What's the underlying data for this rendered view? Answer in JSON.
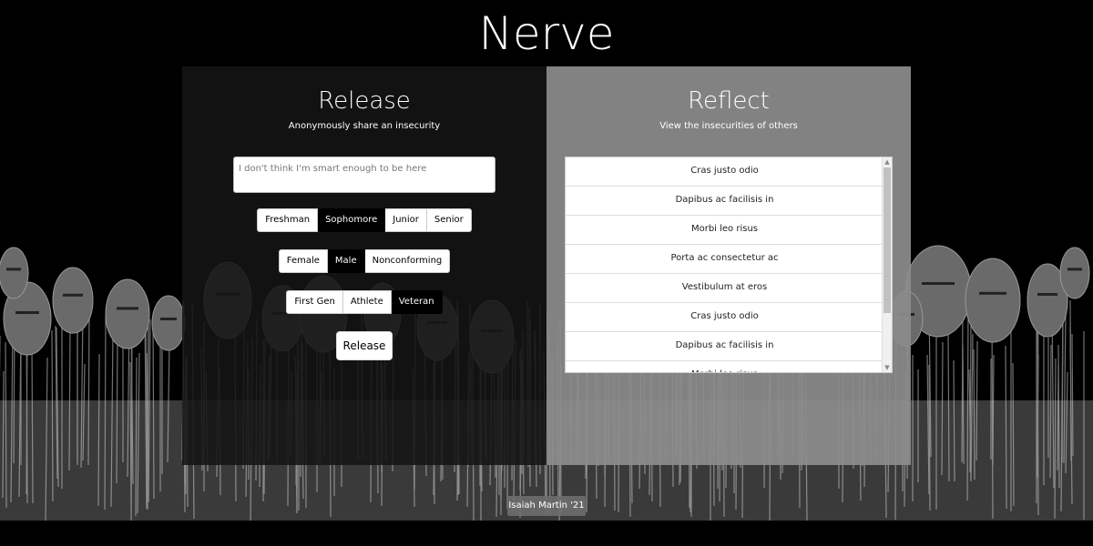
{
  "site": {
    "title": "Nerve"
  },
  "release": {
    "heading": "Release",
    "subheading": "Anonymously share an insecurity",
    "input_value": "I don't think I'm smart enough to be here",
    "year_options": [
      {
        "label": "Freshman",
        "selected": false
      },
      {
        "label": "Sophomore",
        "selected": true
      },
      {
        "label": "Junior",
        "selected": false
      },
      {
        "label": "Senior",
        "selected": false
      }
    ],
    "gender_options": [
      {
        "label": "Female",
        "selected": false
      },
      {
        "label": "Male",
        "selected": true
      },
      {
        "label": "Nonconforming",
        "selected": false
      }
    ],
    "identity_options": [
      {
        "label": "First Gen",
        "selected": false
      },
      {
        "label": "Athlete",
        "selected": false
      },
      {
        "label": "Veteran",
        "selected": true
      }
    ],
    "submit_label": "Release"
  },
  "reflect": {
    "heading": "Reflect",
    "subheading": "View the insecurities of others",
    "items": [
      "Cras justo odio",
      "Dapibus ac facilisis in",
      "Morbi leo risus",
      "Porta ac consectetur ac",
      "Vestibulum at eros",
      "Cras justo odio",
      "Dapibus ac facilisis in",
      "Morbi leo risus"
    ]
  },
  "footer": {
    "credit": "Isaiah Martin '21"
  },
  "icons": {
    "scroll_up": "chevron-up-icon",
    "scroll_down": "chevron-down-icon"
  },
  "colors": {
    "left_panel": "#141414",
    "right_panel": "#8c8c8c",
    "active_segment": "#000000"
  }
}
